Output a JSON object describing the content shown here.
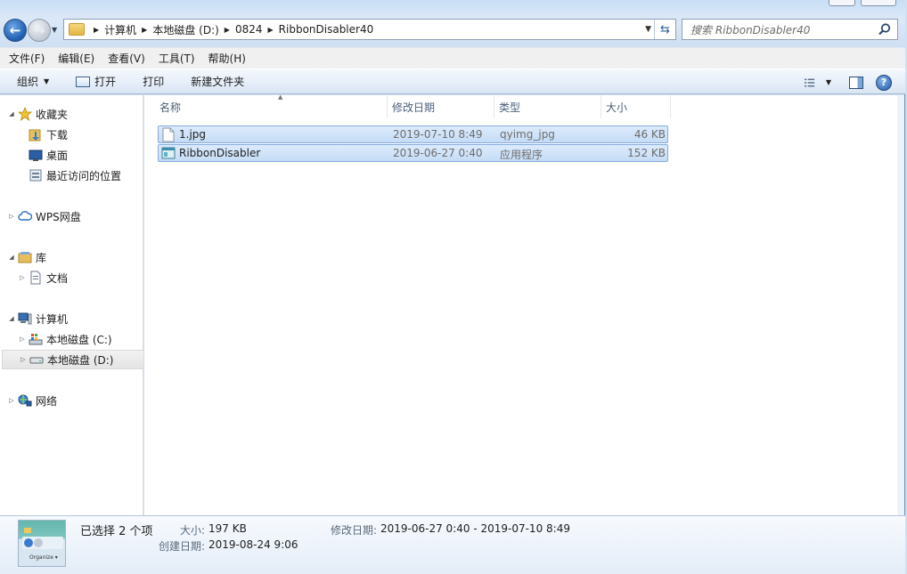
{
  "address": {
    "crumbs": [
      "计算机",
      "本地磁盘 (D:)",
      "0824",
      "RibbonDisabler40"
    ]
  },
  "search": {
    "placeholder": "搜索 RibbonDisabler40"
  },
  "menu": [
    "文件(F)",
    "编辑(E)",
    "查看(V)",
    "工具(T)",
    "帮助(H)"
  ],
  "commands": {
    "organize": "组织",
    "open": "打开",
    "print": "打印",
    "new_folder": "新建文件夹"
  },
  "sidebar": {
    "favorites": "收藏夹",
    "downloads": "下载",
    "desktop": "桌面",
    "recent": "最近访问的位置",
    "wps": "WPS网盘",
    "libraries": "库",
    "documents": "文档",
    "computer": "计算机",
    "drive_c": "本地磁盘 (C:)",
    "drive_d": "本地磁盘 (D:)",
    "network": "网络"
  },
  "columns": {
    "name": "名称",
    "date": "修改日期",
    "type": "类型",
    "size": "大小"
  },
  "files": [
    {
      "name": "1.jpg",
      "date": "2019-07-10 8:49",
      "type": "qyimg_jpg",
      "size": "46 KB"
    },
    {
      "name": "RibbonDisabler",
      "date": "2019-06-27 0:40",
      "type": "应用程序",
      "size": "152 KB"
    }
  ],
  "details": {
    "selected": "已选择 2 个项",
    "size_label": "大小:",
    "size_value": "197 KB",
    "modified_label": "修改日期:",
    "modified_value": "2019-06-27 0:40 - 2019-07-10 8:49",
    "created_label": "创建日期:",
    "created_value": "2019-08-24 9:06",
    "thumb_label": "Organize ▾"
  }
}
